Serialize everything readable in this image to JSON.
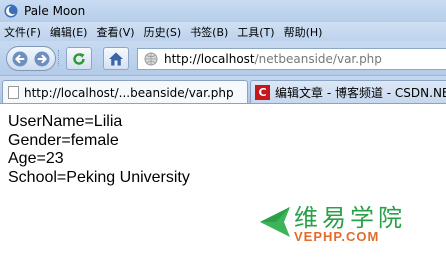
{
  "window": {
    "title": "Pale Moon"
  },
  "menu": [
    "文件(F)",
    "编辑(E)",
    "查看(V)",
    "历史(S)",
    "书签(B)",
    "工具(T)",
    "帮助(H)"
  ],
  "toolbar": {
    "url_host": "http://localhost",
    "url_path": "/netbeanside/var.php"
  },
  "tabs": [
    {
      "label": "http://localhost/...beanside/var.php",
      "icon": "blank-page-icon",
      "active": true
    },
    {
      "label": "编辑文章 - 博客频道 - CSDN.NE",
      "icon": "csdn-icon",
      "active": false
    }
  ],
  "content": {
    "lines": [
      "UserName=Lilia",
      "Gender=female",
      "Age=23",
      "School=Peking University"
    ]
  },
  "watermark": {
    "title": "维易学院",
    "subtitle": "VEPHP.COM"
  },
  "colors": {
    "chrome": "#b6cde9",
    "watermark_green": "#2aa048",
    "watermark_orange": "#e36c2b",
    "csdn_red": "#c8161d"
  }
}
